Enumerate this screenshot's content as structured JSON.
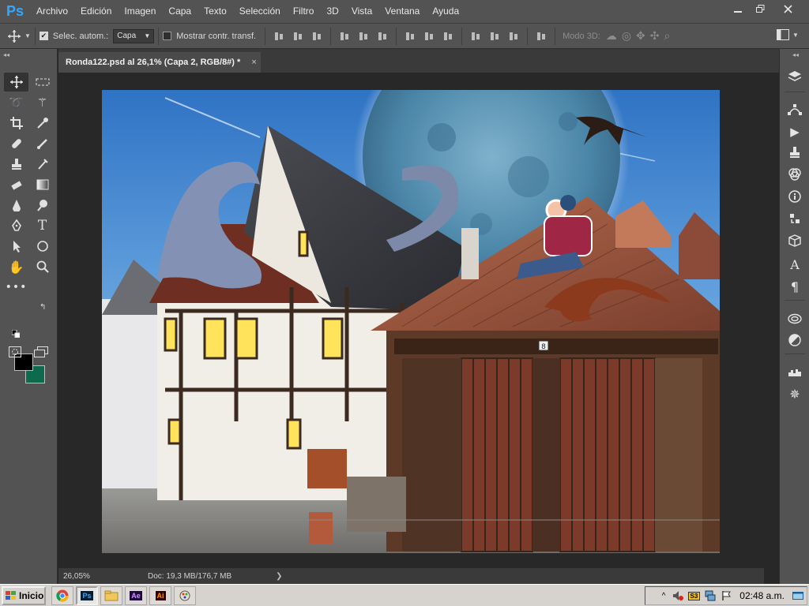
{
  "app": {
    "logo": "Ps",
    "menu": [
      "Archivo",
      "Edición",
      "Imagen",
      "Capa",
      "Texto",
      "Selección",
      "Filtro",
      "3D",
      "Vista",
      "Ventana",
      "Ayuda"
    ],
    "window_controls": [
      "minimize",
      "restore",
      "close"
    ]
  },
  "options_bar": {
    "auto_select_label": "Selec. autom.:",
    "auto_select_checked": true,
    "auto_select_target": "Capa",
    "show_transform_label": "Mostrar contr. transf.",
    "show_transform_checked": false,
    "mode_3d_label": "Modo 3D:"
  },
  "document": {
    "tab_title": "Ronda122.psd al 26,1% (Capa 2, RGB/8#) *",
    "close_glyph": "×"
  },
  "status": {
    "zoom": "26,05%",
    "doc_size": "Doc: 19,3 MB/176,7 MB",
    "arrow": "❯"
  },
  "colors": {
    "foreground": "#000000",
    "background": "#0e6a4c",
    "accent": "#31a8ff"
  },
  "taskbar": {
    "start_label": "Inicio",
    "clock": "02:48 a.m.",
    "apps": [
      "chrome-icon",
      "photoshop-icon",
      "explorer-icon",
      "after-effects-icon",
      "illustrator-icon",
      "paint-icon"
    ],
    "app_labels": {
      "ps": "Ps",
      "ae": "Ae",
      "ai": "Ai"
    }
  },
  "artwork": {
    "image_number": "8"
  }
}
